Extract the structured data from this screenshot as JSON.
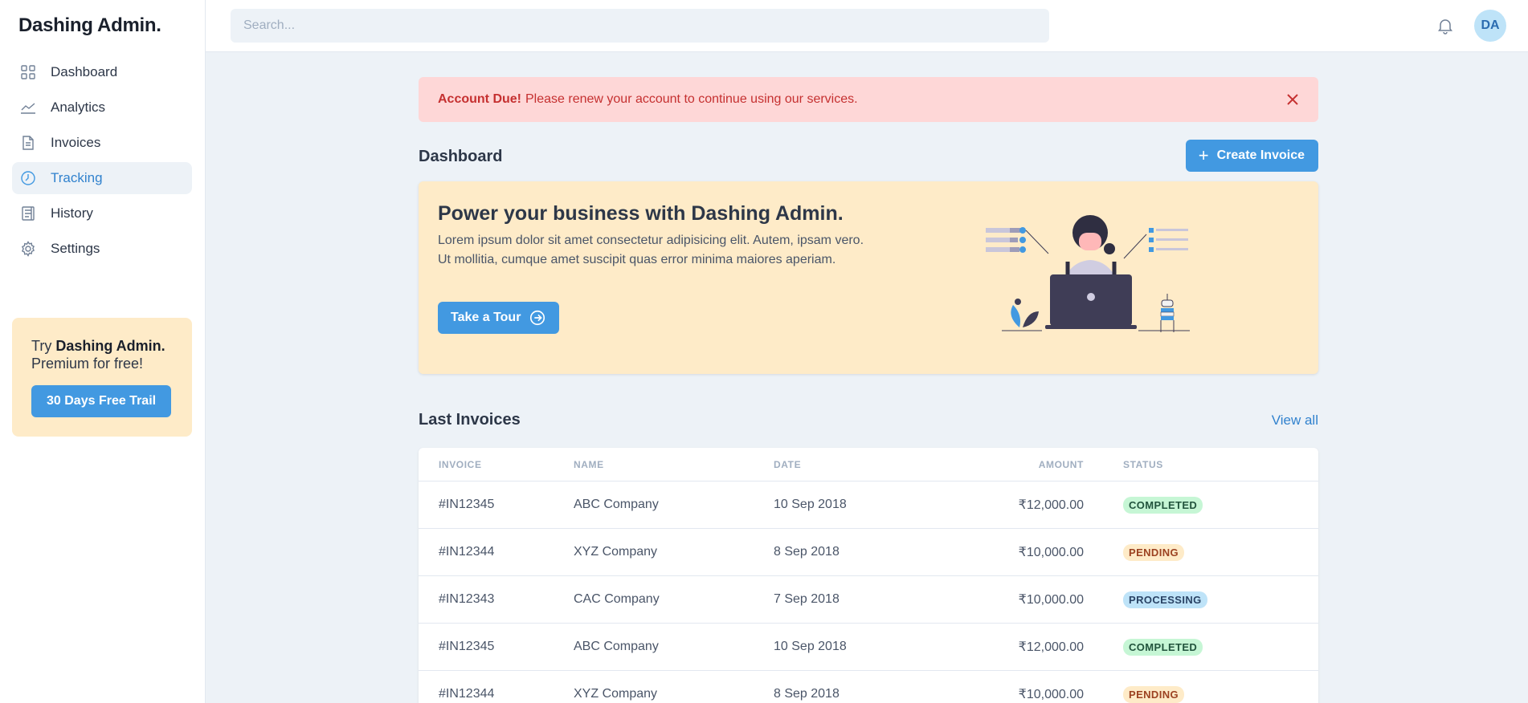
{
  "brand": "Dashing Admin.",
  "sidebar": {
    "items": [
      {
        "label": "Dashboard",
        "icon": "grid-icon",
        "active": false
      },
      {
        "label": "Analytics",
        "icon": "chart-line-icon",
        "active": false
      },
      {
        "label": "Invoices",
        "icon": "document-icon",
        "active": false
      },
      {
        "label": "Tracking",
        "icon": "clock-icon",
        "active": true
      },
      {
        "label": "History",
        "icon": "receipt-icon",
        "active": false
      },
      {
        "label": "Settings",
        "icon": "gear-icon",
        "active": false
      }
    ],
    "promo": {
      "prefix": "Try ",
      "brand": "Dashing Admin.",
      "suffix": "Premium for free!",
      "button": "30 Days Free Trail"
    }
  },
  "topbar": {
    "search_placeholder": "Search...",
    "avatar_initials": "DA"
  },
  "alert": {
    "title": "Account Due!",
    "message": "Please renew your account to continue using our services."
  },
  "dashboard": {
    "title": "Dashboard",
    "create_button": "Create Invoice"
  },
  "hero": {
    "title": "Power your business with Dashing Admin.",
    "text": "Lorem ipsum dolor sit amet consectetur adipisicing elit. Autem, ipsam vero. Ut mollitia, cumque amet suscipit quas error minima maiores aperiam.",
    "button": "Take a Tour"
  },
  "invoices": {
    "title": "Last Invoices",
    "view_all": "View all",
    "columns": [
      "INVOICE",
      "NAME",
      "DATE",
      "AMOUNT",
      "STATUS"
    ],
    "rows": [
      {
        "invoice": "#IN12345",
        "name": "ABC Company",
        "date": "10 Sep 2018",
        "amount": "₹12,000.00",
        "status": "COMPLETED"
      },
      {
        "invoice": "#IN12344",
        "name": "XYZ Company",
        "date": "8 Sep 2018",
        "amount": "₹10,000.00",
        "status": "PENDING"
      },
      {
        "invoice": "#IN12343",
        "name": "CAC Company",
        "date": "7 Sep 2018",
        "amount": "₹10,000.00",
        "status": "PROCESSING"
      },
      {
        "invoice": "#IN12345",
        "name": "ABC Company",
        "date": "10 Sep 2018",
        "amount": "₹12,000.00",
        "status": "COMPLETED"
      },
      {
        "invoice": "#IN12344",
        "name": "XYZ Company",
        "date": "8 Sep 2018",
        "amount": "₹10,000.00",
        "status": "PENDING"
      }
    ]
  },
  "colors": {
    "accent": "#4299e1",
    "completed_bg": "#c6f6d5",
    "completed_fg": "#22543d",
    "pending_bg": "#feebc8",
    "pending_fg": "#9c4221",
    "processing_bg": "#bee3f8",
    "processing_fg": "#2a4365"
  }
}
